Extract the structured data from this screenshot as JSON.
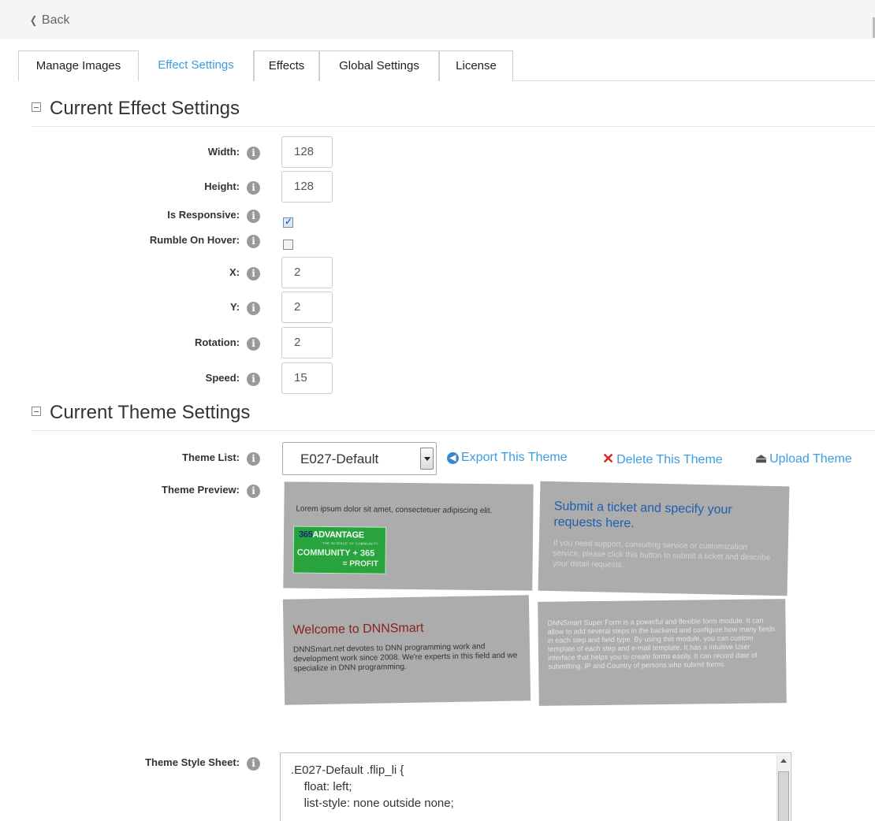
{
  "nav": {
    "back_label": "Back"
  },
  "tabs": [
    {
      "label": "Manage Images"
    },
    {
      "label": "Effect Settings"
    },
    {
      "label": "Effects"
    },
    {
      "label": "Global Settings"
    },
    {
      "label": "License"
    }
  ],
  "active_tab": "Effect Settings",
  "effect_section": {
    "title": "Current Effect Settings",
    "fields": {
      "width": {
        "label": "Width:",
        "value": "128"
      },
      "height": {
        "label": "Height:",
        "value": "128"
      },
      "is_responsive": {
        "label": "Is Responsive:",
        "checked": true
      },
      "rumble_on_hover": {
        "label": "Rumble On Hover:",
        "checked": false
      },
      "x": {
        "label": "X:",
        "value": "2"
      },
      "y": {
        "label": "Y:",
        "value": "2"
      },
      "rotation": {
        "label": "Rotation:",
        "value": "2"
      },
      "speed": {
        "label": "Speed:",
        "value": "15"
      }
    }
  },
  "theme_section": {
    "title": "Current Theme Settings",
    "theme_list_label": "Theme List:",
    "theme_selected": "E027-Default",
    "export_label": "Export This Theme",
    "delete_label": "Delete This Theme",
    "upload_label": "Upload Theme",
    "preview_label": "Theme Preview:",
    "preview": {
      "card1_text": "Lorem ipsum dolor sit amet, consectetuer adipiscing elit.",
      "logo": {
        "brand": "365ADVANTAGE",
        "tagline": "THE SCIENCE OF COMMUNITY",
        "line1": "COMMUNITY + 365",
        "line2": "= PROFIT"
      },
      "card2_title": "Submit a ticket and specify your requests here.",
      "card2_text": "If you need support, consulting service or customization service, please click this button to submit a ticket and describe your detail requests.",
      "card3_title": "Welcome to DNNSmart",
      "card3_text": "DNNSmart.net devotes to DNN programming work and development work since 2008. We're experts in this field and we specialize in DNN programming.",
      "card4_text": "DNNSmart Super Form is a powerful and flexible form module. It can allow to add several steps in the backend and configure how many fields in each step and field type. By using this module, you can custom template of each step and e-mail template. It has a intuitive User interface that helps you to create forms easily. It can record date of submitting, IP and Country of persons who submit forms."
    },
    "stylesheet_label": "Theme Style Sheet:",
    "stylesheet_text": ".E027-Default .flip_li {\n    float: left;\n    list-style: none outside none;"
  },
  "colors": {
    "link": "#3a9de0",
    "delete_x": "#d9251c",
    "card_bg": "#acacac",
    "card_title_blue": "#1f5fb0",
    "card_title_red": "#8b1f1f"
  }
}
